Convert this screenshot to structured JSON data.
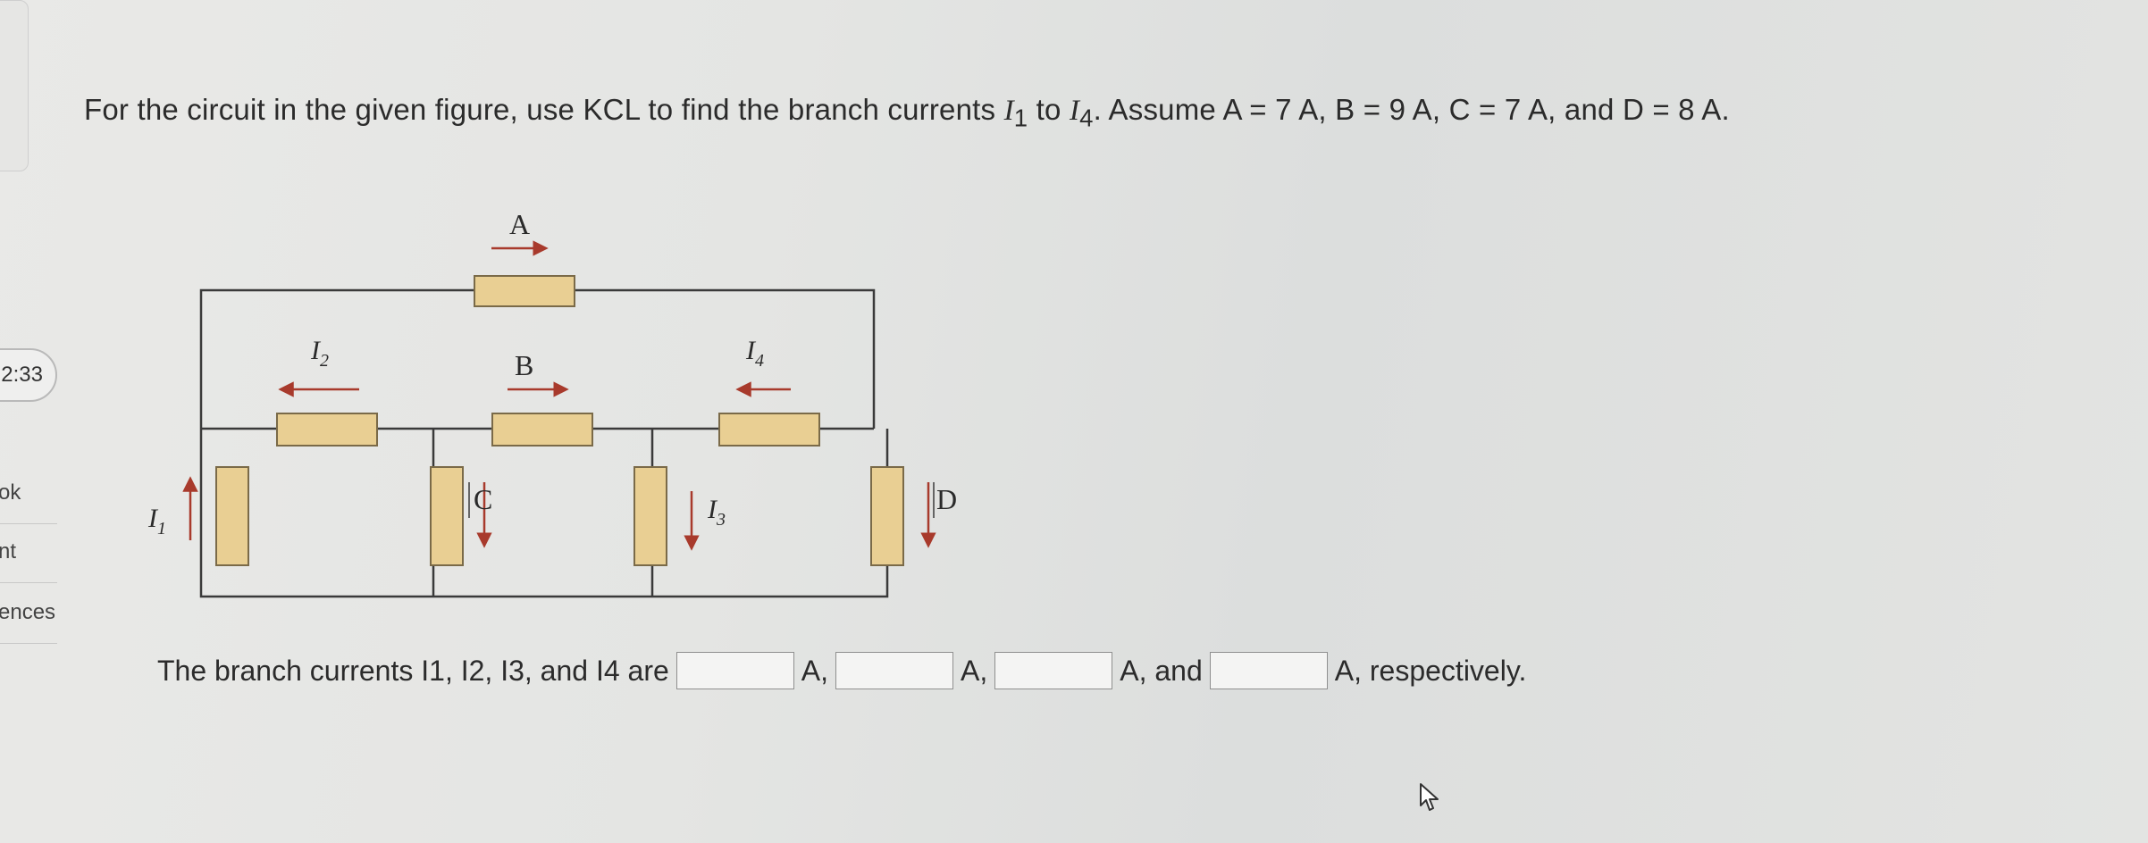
{
  "sidebar": {
    "timer": "2:33",
    "links": [
      "ok",
      "nt",
      "ences"
    ]
  },
  "question": {
    "text_before": "For the circuit in the given figure, use KCL to find the branch currents ",
    "i1": "I",
    "i1_sub": "1",
    "text_to": " to ",
    "i4": "I",
    "i4_sub": "4",
    "text_after": ". Assume A = 7 A, B = 9 A, C = 7 A, and D = 8 A."
  },
  "circuit": {
    "labels": {
      "A": "A",
      "B": "B",
      "C": "C",
      "D": "D",
      "I1": "I",
      "I1_sub": "1",
      "I2": "I",
      "I2_sub": "2",
      "I3": "I",
      "I3_sub": "3",
      "I4": "I",
      "I4_sub": "4"
    },
    "colors": {
      "resistor_fill": "#e9cf93",
      "resistor_stroke": "#7a6a48",
      "arrow": "#a83a2c",
      "wire": "#3a3a3a"
    }
  },
  "answer": {
    "prefix": "The branch currents I1, I2, I3, and I4 are",
    "sep1": "A,",
    "sep2": "A,",
    "sep3": "A, and",
    "suffix": "A, respectively.",
    "box1_value": "",
    "box2_value": "",
    "box3_value": "",
    "box4_value": ""
  },
  "cursor": {
    "icon": "pointer-cursor-icon"
  }
}
